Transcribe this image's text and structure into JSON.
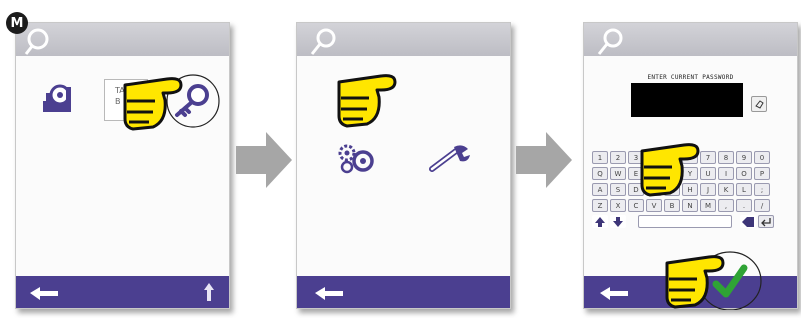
{
  "badge": {
    "label": "M"
  },
  "screen1": {
    "top_icon": "key-icon",
    "items": [
      {
        "icon": "sensor-chart-icon"
      },
      {
        "label_line1": "TA",
        "label_line2": "B",
        "icon": "key-icon"
      }
    ],
    "back_icon": "back-arrow-icon",
    "up_icon": "up-arrow-icon"
  },
  "screen2": {
    "top_icon": "key-icon",
    "items": [
      {
        "icon": "gears-icon"
      },
      {
        "icon": "wrench-icon"
      }
    ],
    "back_icon": "back-arrow-icon"
  },
  "screen3": {
    "top_icon": "key-icon",
    "password_label": "ENTER CURRENT PASSWORD",
    "keyboard": {
      "row1": [
        "1",
        "2",
        "3",
        "4",
        "5",
        "6",
        "7",
        "8",
        "9",
        "0"
      ],
      "row2": [
        "Q",
        "W",
        "E",
        "R",
        "T",
        "Y",
        "U",
        "I",
        "O",
        "P"
      ],
      "row3": [
        "A",
        "S",
        "D",
        "F",
        "G",
        "H",
        "J",
        "K",
        "L",
        ";"
      ],
      "row4": [
        "Z",
        "X",
        "C",
        "V",
        "B",
        "N",
        "M",
        ",",
        ".",
        "/"
      ]
    },
    "confirm_icon": "check-icon",
    "back_icon": "back-arrow-icon"
  },
  "colors": {
    "bar": "#4b3f90",
    "hand": "#ffe600",
    "check": "#2fa335",
    "arrow": "#a6a6a6"
  }
}
